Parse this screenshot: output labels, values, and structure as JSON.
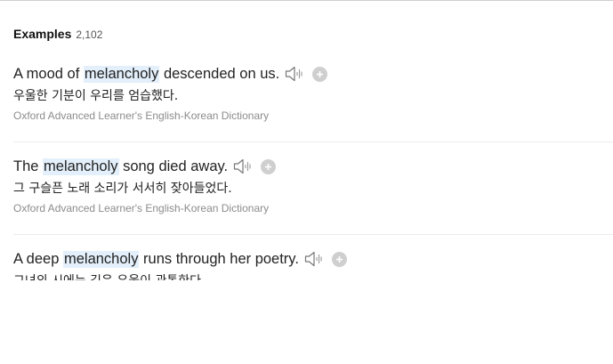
{
  "examples_section": {
    "title": "Examples",
    "count": "2,102"
  },
  "examples": [
    {
      "before": "A mood of ",
      "highlight": "melancholy",
      "after": " descended on us.",
      "translation": "우울한 기분이 우리를 엄습했다.",
      "source": "Oxford Advanced Learner's English-Korean Dictionary"
    },
    {
      "before": "The ",
      "highlight": "melancholy",
      "after": " song died away.",
      "translation": "그 구슬픈 노래 소리가 서서히 잦아들었다.",
      "source": "Oxford Advanced Learner's English-Korean Dictionary"
    },
    {
      "before": "A deep ",
      "highlight": "melancholy",
      "after": " runs through her poetry.",
      "translation": "그녀의 시에는 깊은 우울이 관통한다"
    }
  ],
  "icons": {
    "speaker": "speaker-icon",
    "add": "plus-circle-icon"
  },
  "colors": {
    "highlight": "#e3effa",
    "source_text": "#8c8c8c",
    "add_button": "#cfcfcf",
    "speaker_icon": "#777777"
  }
}
